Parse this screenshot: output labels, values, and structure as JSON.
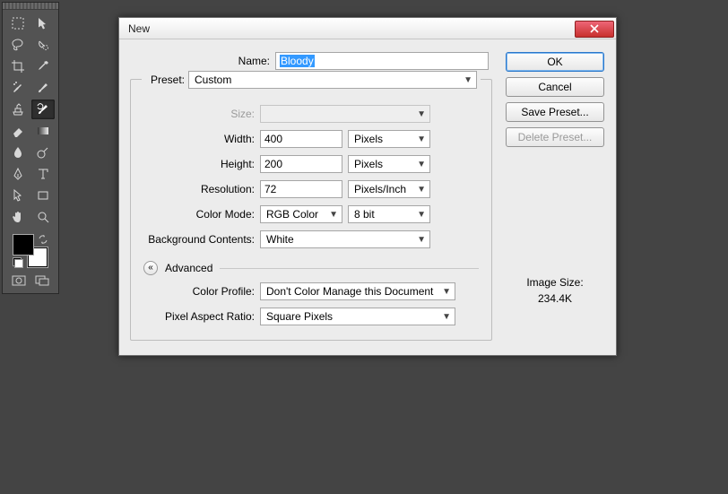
{
  "dialog": {
    "title": "New",
    "name_label": "Name:",
    "name_value": "Bloody",
    "preset_label": "Preset:",
    "preset_value": "Custom",
    "size_label": "Size:",
    "size_value": "",
    "width_label": "Width:",
    "width_value": "400",
    "width_unit": "Pixels",
    "height_label": "Height:",
    "height_value": "200",
    "height_unit": "Pixels",
    "resolution_label": "Resolution:",
    "resolution_value": "72",
    "resolution_unit": "Pixels/Inch",
    "color_mode_label": "Color Mode:",
    "color_mode_value": "RGB Color",
    "color_depth_value": "8 bit",
    "bg_label": "Background Contents:",
    "bg_value": "White",
    "advanced_label": "Advanced",
    "color_profile_label": "Color Profile:",
    "color_profile_value": "Don't Color Manage this Document",
    "par_label": "Pixel Aspect Ratio:",
    "par_value": "Square Pixels",
    "image_size_label": "Image Size:",
    "image_size_value": "234.4K",
    "buttons": {
      "ok": "OK",
      "cancel": "Cancel",
      "save_preset": "Save Preset...",
      "delete_preset": "Delete Preset..."
    }
  },
  "tools": {
    "items": [
      "move",
      "marquee",
      "lasso",
      "quick-select",
      "crop",
      "eyedropper",
      "healing-brush",
      "brush",
      "clone-stamp",
      "history-brush",
      "eraser",
      "gradient",
      "blur",
      "dodge",
      "pen",
      "type",
      "path-select",
      "shape",
      "hand",
      "zoom"
    ],
    "selected": "history-brush",
    "modes": {
      "standard": "standard-mode",
      "screen": "screen-mode"
    }
  }
}
